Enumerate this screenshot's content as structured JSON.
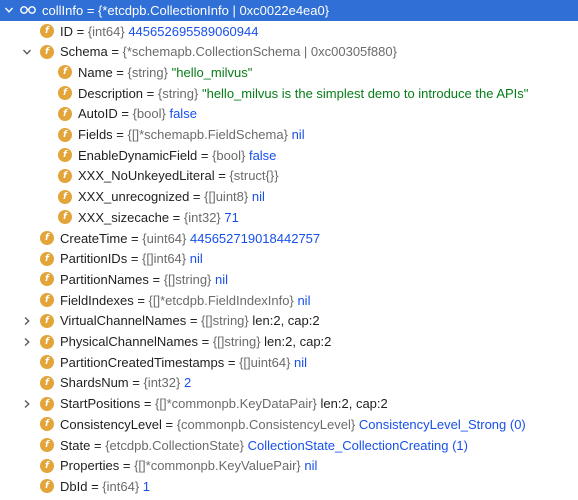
{
  "root": {
    "name": "collInfo",
    "type": "{*etcdpb.CollectionInfo | 0xc0022e4ea0}"
  },
  "rows": [
    {
      "name": "ID",
      "type": "{int64}",
      "value": "445652695589060944",
      "value_kind": "num",
      "level": 1,
      "arrow": "none"
    },
    {
      "name": "Schema",
      "type": "{*schemapb.CollectionSchema | 0xc00305f880}",
      "value": "",
      "value_kind": "num",
      "level": 1,
      "arrow": "expanded"
    },
    {
      "name": "Name",
      "type": "{string}",
      "value": "\"hello_milvus\"",
      "value_kind": "str",
      "level": 2,
      "arrow": "none"
    },
    {
      "name": "Description",
      "type": "{string}",
      "value": "\"hello_milvus is the simplest demo to introduce the APIs\"",
      "value_kind": "str",
      "level": 2,
      "arrow": "none"
    },
    {
      "name": "AutoID",
      "type": "{bool}",
      "value": "false",
      "value_kind": "num",
      "level": 2,
      "arrow": "none"
    },
    {
      "name": "Fields",
      "type": "{[]*schemapb.FieldSchema}",
      "value": "nil",
      "value_kind": "num",
      "level": 2,
      "arrow": "none"
    },
    {
      "name": "EnableDynamicField",
      "type": "{bool}",
      "value": "false",
      "value_kind": "num",
      "level": 2,
      "arrow": "none"
    },
    {
      "name": "XXX_NoUnkeyedLiteral",
      "type": "{struct{}}",
      "value": "",
      "value_kind": "num",
      "level": 2,
      "arrow": "none"
    },
    {
      "name": "XXX_unrecognized",
      "type": "{[]uint8}",
      "value": "nil",
      "value_kind": "num",
      "level": 2,
      "arrow": "none"
    },
    {
      "name": "XXX_sizecache",
      "type": "{int32}",
      "value": "71",
      "value_kind": "num",
      "level": 2,
      "arrow": "none"
    },
    {
      "name": "CreateTime",
      "type": "{uint64}",
      "value": "445652719018442757",
      "value_kind": "num",
      "level": 1,
      "arrow": "none"
    },
    {
      "name": "PartitionIDs",
      "type": "{[]int64}",
      "value": "nil",
      "value_kind": "num",
      "level": 1,
      "arrow": "none"
    },
    {
      "name": "PartitionNames",
      "type": "{[]string}",
      "value": "nil",
      "value_kind": "num",
      "level": 1,
      "arrow": "none"
    },
    {
      "name": "FieldIndexes",
      "type": "{[]*etcdpb.FieldIndexInfo}",
      "value": "nil",
      "value_kind": "num",
      "level": 1,
      "arrow": "none"
    },
    {
      "name": "VirtualChannelNames",
      "type": "{[]string}",
      "value": "len:2, cap:2",
      "value_kind": "plain",
      "level": 1,
      "arrow": "collapsed"
    },
    {
      "name": "PhysicalChannelNames",
      "type": "{[]string}",
      "value": "len:2, cap:2",
      "value_kind": "plain",
      "level": 1,
      "arrow": "collapsed"
    },
    {
      "name": "PartitionCreatedTimestamps",
      "type": "{[]uint64}",
      "value": "nil",
      "value_kind": "num",
      "level": 1,
      "arrow": "none"
    },
    {
      "name": "ShardsNum",
      "type": "{int32}",
      "value": "2",
      "value_kind": "num",
      "level": 1,
      "arrow": "none"
    },
    {
      "name": "StartPositions",
      "type": "{[]*commonpb.KeyDataPair}",
      "value": "len:2, cap:2",
      "value_kind": "plain",
      "level": 1,
      "arrow": "collapsed"
    },
    {
      "name": "ConsistencyLevel",
      "type": "{commonpb.ConsistencyLevel}",
      "value": "ConsistencyLevel_Strong (0)",
      "value_kind": "num",
      "level": 1,
      "arrow": "none"
    },
    {
      "name": "State",
      "type": "{etcdpb.CollectionState}",
      "value": "CollectionState_CollectionCreating (1)",
      "value_kind": "num",
      "level": 1,
      "arrow": "none"
    },
    {
      "name": "Properties",
      "type": "{[]*commonpb.KeyValuePair}",
      "value": "nil",
      "value_kind": "num",
      "level": 1,
      "arrow": "none"
    },
    {
      "name": "DbId",
      "type": "{int64}",
      "value": "1",
      "value_kind": "num",
      "level": 1,
      "arrow": "none"
    }
  ],
  "colors": {
    "selection": "#2f6fd6",
    "field_icon": "#e3a43a",
    "number_value": "#1750eb",
    "string_value": "#067d17",
    "type_text": "#6b6b6b"
  },
  "icons": {
    "root": "watch-glasses-icon",
    "field": "field-f-icon",
    "expanded": "chevron-down-icon",
    "collapsed": "chevron-right-icon"
  }
}
